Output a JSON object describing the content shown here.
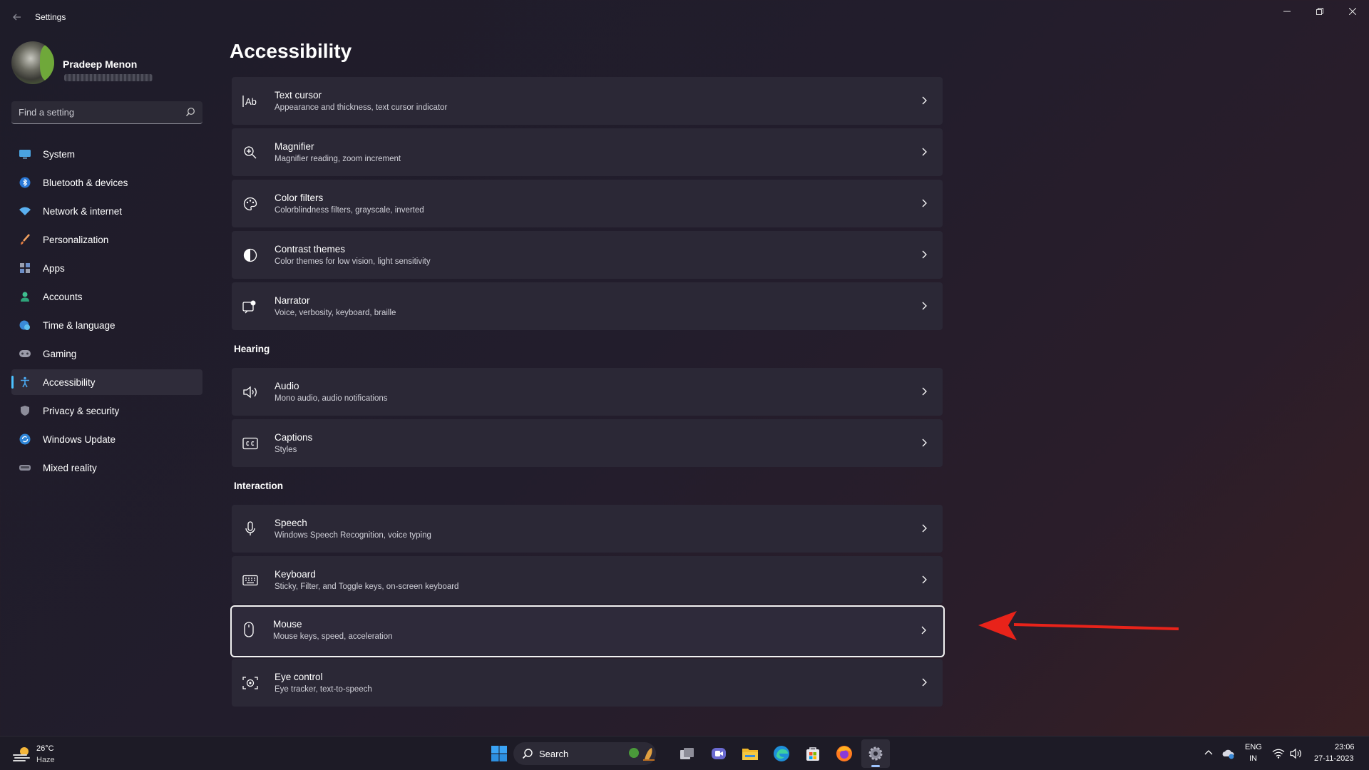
{
  "window": {
    "app_title": "Settings"
  },
  "profile": {
    "name": "Pradeep Menon"
  },
  "search": {
    "placeholder": "Find a setting"
  },
  "sidebar": {
    "items": [
      {
        "label": "System",
        "icon": "monitor-icon",
        "active": false
      },
      {
        "label": "Bluetooth & devices",
        "icon": "bluetooth-icon",
        "active": false
      },
      {
        "label": "Network & internet",
        "icon": "wifi-icon",
        "active": false
      },
      {
        "label": "Personalization",
        "icon": "brush-icon",
        "active": false
      },
      {
        "label": "Apps",
        "icon": "apps-icon",
        "active": false
      },
      {
        "label": "Accounts",
        "icon": "person-icon",
        "active": false
      },
      {
        "label": "Time & language",
        "icon": "globe-clock-icon",
        "active": false
      },
      {
        "label": "Gaming",
        "icon": "gamepad-icon",
        "active": false
      },
      {
        "label": "Accessibility",
        "icon": "accessibility-icon",
        "active": true
      },
      {
        "label": "Privacy & security",
        "icon": "shield-icon",
        "active": false
      },
      {
        "label": "Windows Update",
        "icon": "update-icon",
        "active": false
      },
      {
        "label": "Mixed reality",
        "icon": "vr-headset-icon",
        "active": false
      }
    ]
  },
  "main": {
    "title": "Accessibility",
    "vision_items": [
      {
        "title": "Text cursor",
        "desc": "Appearance and thickness, text cursor indicator",
        "icon": "text-cursor-icon"
      },
      {
        "title": "Magnifier",
        "desc": "Magnifier reading, zoom increment",
        "icon": "magnifier-icon"
      },
      {
        "title": "Color filters",
        "desc": "Colorblindness filters, grayscale, inverted",
        "icon": "palette-icon"
      },
      {
        "title": "Contrast themes",
        "desc": "Color themes for low vision, light sensitivity",
        "icon": "contrast-icon"
      },
      {
        "title": "Narrator",
        "desc": "Voice, verbosity, keyboard, braille",
        "icon": "narrator-icon"
      }
    ],
    "hearing_heading": "Hearing",
    "hearing_items": [
      {
        "title": "Audio",
        "desc": "Mono audio, audio notifications",
        "icon": "speaker-icon"
      },
      {
        "title": "Captions",
        "desc": "Styles",
        "icon": "captions-icon"
      }
    ],
    "interaction_heading": "Interaction",
    "interaction_items": [
      {
        "title": "Speech",
        "desc": "Windows Speech Recognition, voice typing",
        "icon": "microphone-icon"
      },
      {
        "title": "Keyboard",
        "desc": "Sticky, Filter, and Toggle keys, on-screen keyboard",
        "icon": "keyboard-icon"
      },
      {
        "title": "Mouse",
        "desc": "Mouse keys, speed, acceleration",
        "icon": "mouse-icon",
        "highlighted": true
      },
      {
        "title": "Eye control",
        "desc": "Eye tracker, text-to-speech",
        "icon": "eye-icon"
      }
    ]
  },
  "annotation": {
    "color": "#e8231a"
  },
  "taskbar": {
    "weather": {
      "temp": "26°C",
      "condition": "Haze"
    },
    "search_label": "Search",
    "apps": [
      "start-icon",
      "search-icon",
      "task-view-icon",
      "teams-icon",
      "file-explorer-icon",
      "edge-icon",
      "store-icon",
      "firefox-icon",
      "settings-icon"
    ],
    "language": {
      "top": "ENG",
      "bottom": "IN"
    },
    "clock": {
      "time": "23:06",
      "date": "27-11-2023"
    }
  },
  "colors": {
    "accent": "#4cc2ff",
    "card": "#2b2836",
    "background": "#201d2a"
  }
}
